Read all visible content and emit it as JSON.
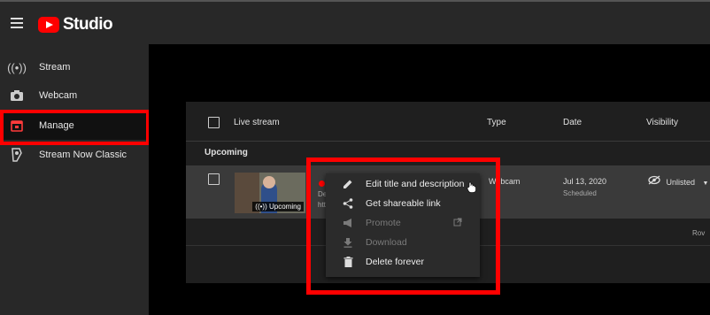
{
  "app": {
    "title": "Studio"
  },
  "sidebar": {
    "items": [
      {
        "label": "Stream",
        "icon": "live-signal-icon"
      },
      {
        "label": "Webcam",
        "icon": "camera-icon"
      },
      {
        "label": "Manage",
        "icon": "calendar-icon"
      },
      {
        "label": "Stream Now Classic",
        "icon": "classic-stream-icon"
      }
    ]
  },
  "table": {
    "headers": {
      "live_stream": "Live stream",
      "type": "Type",
      "date": "Date",
      "visibility": "Visibility"
    },
    "section": "Upcoming",
    "rows": [
      {
        "thumbnail_badge": "Upcoming",
        "desc_trunc": "De",
        "link_trunc": "htt",
        "type": "Webcam",
        "date": "Jul 13, 2020",
        "date_status": "Scheduled",
        "visibility": "Unlisted"
      }
    ],
    "footer_trunc": "Rov"
  },
  "context_menu": {
    "items": [
      {
        "label": "Edit title and description",
        "icon": "pencil-icon",
        "enabled": true
      },
      {
        "label": "Get shareable link",
        "icon": "share-icon",
        "enabled": true
      },
      {
        "label": "Promote",
        "icon": "megaphone-icon",
        "enabled": false
      },
      {
        "label": "Download",
        "icon": "download-icon",
        "enabled": false
      },
      {
        "label": "Delete forever",
        "icon": "trash-icon",
        "enabled": true
      }
    ]
  },
  "colors": {
    "highlight": "#ff0000",
    "brand": "#ff0000"
  }
}
